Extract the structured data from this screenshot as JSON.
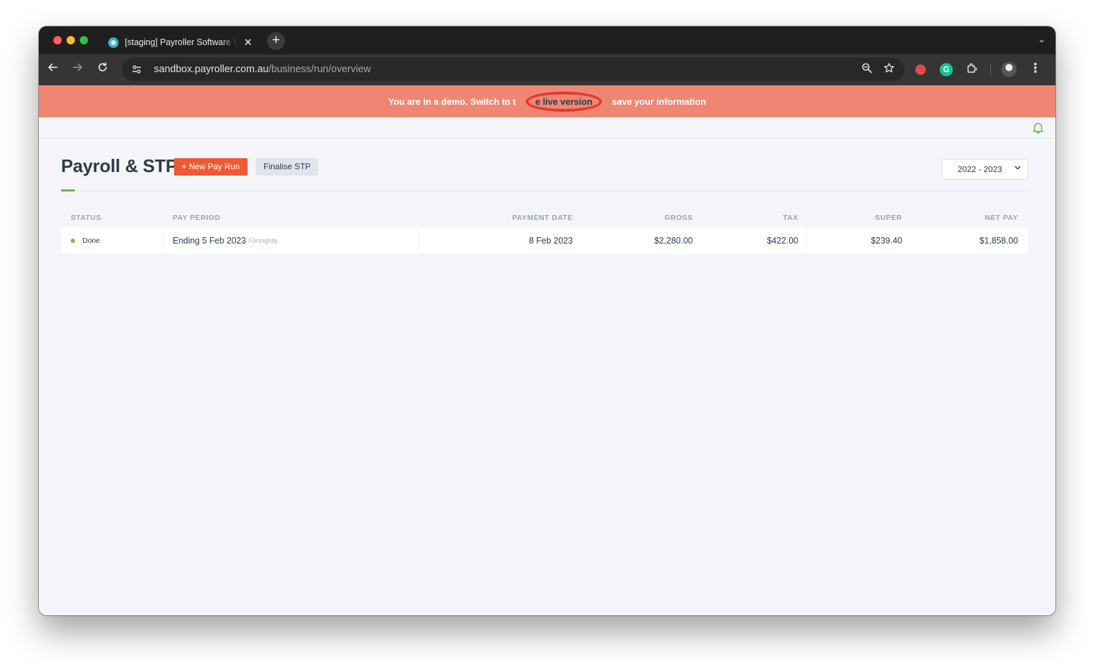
{
  "browser": {
    "tab_title": "[staging] Payroller Software V",
    "new_tab_symbol": "+",
    "close_symbol": "✕",
    "url_host": "sandbox.payroller.com.au",
    "url_path": "/business/run/overview",
    "extension_label": "G"
  },
  "banner": {
    "text_before": "You are in a demo. Switch to t",
    "link_text": "e live version",
    "text_after": "save your information"
  },
  "page": {
    "title": "Payroll & STP",
    "new_pay_run_label": "+ New Pay Run",
    "finalise_stp_label": "Finalise STP",
    "year_selected": "2022 - 2023"
  },
  "table": {
    "columns": [
      "STATUS",
      "PAY PERIOD",
      "PAYMENT DATE",
      "GROSS",
      "TAX",
      "SUPER",
      "NET PAY"
    ],
    "rows": [
      {
        "status": "Done",
        "pay_period": "Ending 5 Feb 2023",
        "frequency": "Fortnightly",
        "payment_date": "8 Feb 2023",
        "gross": "$2,280.00",
        "tax": "$422.00",
        "super": "$239.40",
        "net_pay": "$1,858.00"
      }
    ]
  },
  "colors": {
    "banner_bg": "#ef8673",
    "primary_button": "#ee5a35",
    "accent_green": "#72b043",
    "status_done": "#6cbd3b"
  },
  "icons": {
    "back": "arrow-left-icon",
    "forward": "arrow-right-icon",
    "reload": "reload-icon",
    "zoom": "zoom-icon",
    "bookmark": "star-icon",
    "notifications": "bell-icon"
  }
}
